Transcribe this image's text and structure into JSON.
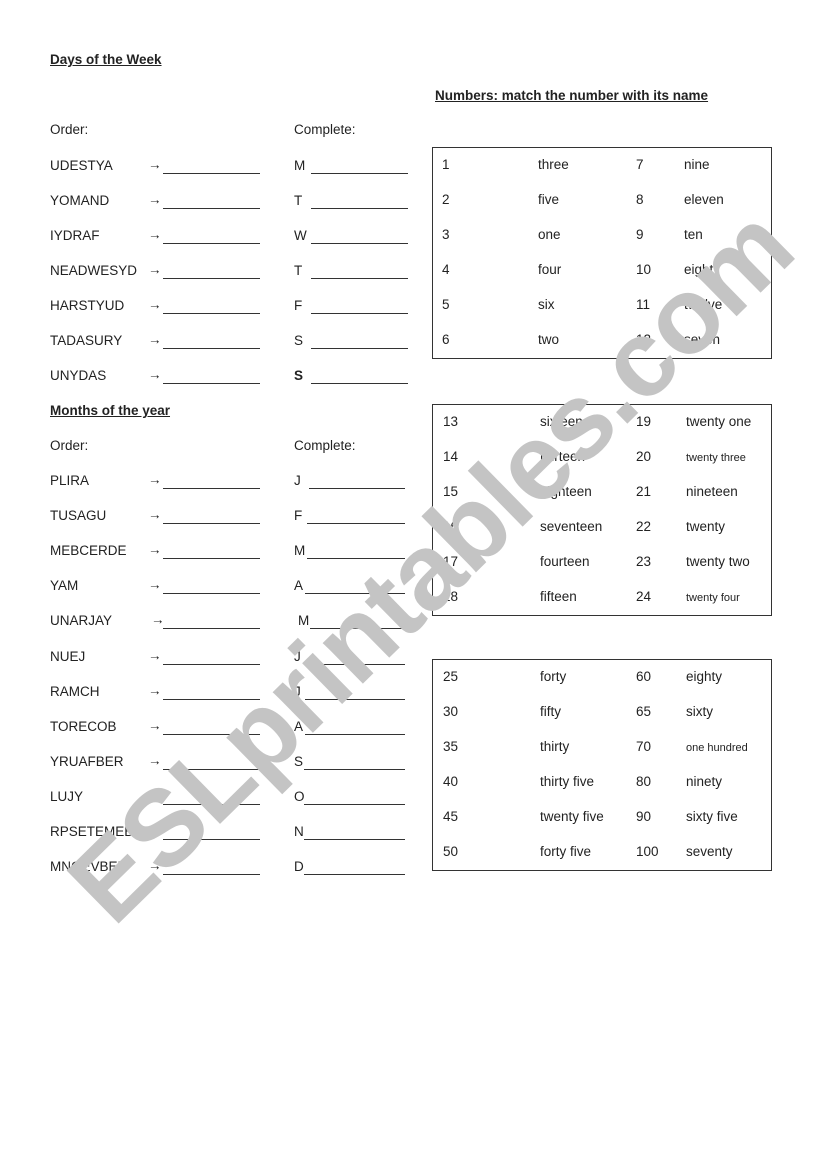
{
  "days": {
    "title": "Days of the Week",
    "order_label": "Order:",
    "complete_label": "Complete:",
    "arrow_glyph": "→",
    "rows": [
      {
        "scrambled": "UDESTYA",
        "letter": "M",
        "bold": false
      },
      {
        "scrambled": "YOMAND",
        "letter": "T",
        "bold": false
      },
      {
        "scrambled": "IYDRAF",
        "letter": "W",
        "bold": false
      },
      {
        "scrambled": "NEADWESYD",
        "letter": "T",
        "bold": false
      },
      {
        "scrambled": "HARSTYUD",
        "letter": "F",
        "bold": false
      },
      {
        "scrambled": "TADASURY",
        "letter": "S",
        "bold": false
      },
      {
        "scrambled": "UNYDAS",
        "letter": "S",
        "bold": true
      }
    ]
  },
  "months": {
    "title": "Months of the year",
    "order_label": "Order:",
    "complete_label": "Complete:",
    "rows": [
      {
        "scrambled": "PLIRA",
        "letter": "J"
      },
      {
        "scrambled": "TUSAGU",
        "letter": "F"
      },
      {
        "scrambled": "MEBCERDE",
        "letter": "M"
      },
      {
        "scrambled": "YAM",
        "letter": "A"
      },
      {
        "scrambled": "UNARJAY",
        "letter": "M"
      },
      {
        "scrambled": "NUEJ",
        "letter": "J"
      },
      {
        "scrambled": "RAMCH",
        "letter": "J"
      },
      {
        "scrambled": "TORECOB",
        "letter": "A"
      },
      {
        "scrambled": "YRUAFBER",
        "letter": "S"
      },
      {
        "scrambled": "LUJY",
        "letter": "O"
      },
      {
        "scrambled": "RPSETEMEB",
        "letter": "N"
      },
      {
        "scrambled": "MNOEVBER",
        "letter": "D"
      }
    ]
  },
  "numbers": {
    "title": "Numbers: match the number with its name",
    "boxes": [
      {
        "rows": [
          {
            "n1": "1",
            "w1": "three",
            "n2": "7",
            "w2": "nine"
          },
          {
            "n1": "2",
            "w1": "five",
            "n2": "8",
            "w2": "eleven"
          },
          {
            "n1": "3",
            "w1": "one",
            "n2": "9",
            "w2": "ten"
          },
          {
            "n1": "4",
            "w1": "four",
            "n2": "10",
            "w2": "eight"
          },
          {
            "n1": "5",
            "w1": "six",
            "n2": "11",
            "w2": "twelve"
          },
          {
            "n1": "6",
            "w1": "two",
            "n2": "12",
            "w2": "seven"
          }
        ]
      },
      {
        "rows": [
          {
            "n1": "13",
            "w1": "sixteen",
            "n2": "19",
            "w2": "twenty one"
          },
          {
            "n1": "14",
            "w1": "thirteen",
            "n2": "20",
            "w2": "twenty three",
            "w2_small": true
          },
          {
            "n1": "15",
            "w1": "eighteen",
            "n2": "21",
            "w2": "nineteen"
          },
          {
            "n1": "16",
            "w1": "seventeen",
            "n2": "22",
            "w2": "twenty"
          },
          {
            "n1": "17",
            "w1": "fourteen",
            "n2": "23",
            "w2": "twenty two"
          },
          {
            "n1": "18",
            "w1": "fifteen",
            "n2": "24",
            "w2": "twenty four",
            "w2_small": true
          }
        ]
      },
      {
        "rows": [
          {
            "n1": "25",
            "w1": "forty",
            "n2": "60",
            "w2": "eighty"
          },
          {
            "n1": "30",
            "w1": "fifty",
            "n2": "65",
            "w2": "sixty"
          },
          {
            "n1": "35",
            "w1": "thirty",
            "n2": "70",
            "w2": "one hundred",
            "w2_small": true
          },
          {
            "n1": "40",
            "w1": "thirty five",
            "n2": "80",
            "w2": "ninety"
          },
          {
            "n1": "45",
            "w1": "twenty five",
            "n2": "90",
            "w2": "sixty five"
          },
          {
            "n1": "50",
            "w1": "forty five",
            "n2": "100",
            "w2": "seventy"
          }
        ]
      }
    ]
  },
  "watermark": {
    "text": "ESLprintables.com",
    "color": "#c4c4c4"
  }
}
